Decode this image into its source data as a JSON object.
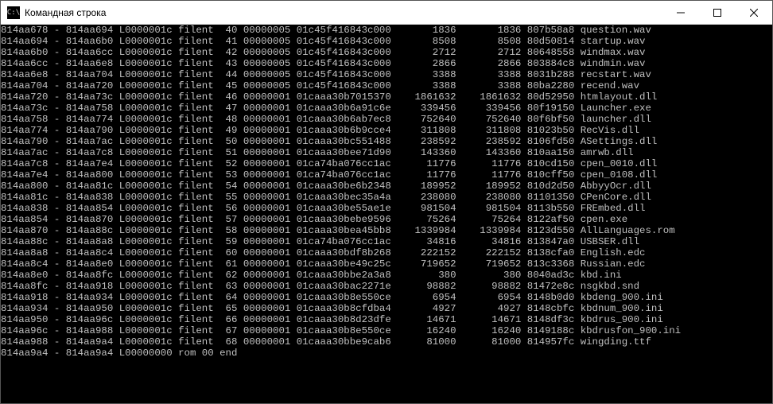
{
  "window": {
    "title": "Командная строка",
    "icon_text": "C:\\"
  },
  "rows": [
    {
      "addr1": "814aa678",
      "addr2": "814aa694",
      "lval": "L0000001c",
      "type": "filent",
      "idx": "40",
      "col6": "00000005",
      "col7": "01c45f416843c000",
      "col8": "      1836",
      "col9": "      1836",
      "col10": "807b58a8",
      "fname": "question.wav"
    },
    {
      "addr1": "814aa694",
      "addr2": "814aa6b0",
      "lval": "L0000001c",
      "type": "filent",
      "idx": "41",
      "col6": "00000005",
      "col7": "01c45f416843c000",
      "col8": "      8508",
      "col9": "      8508",
      "col10": "80d50814",
      "fname": "startup.wav"
    },
    {
      "addr1": "814aa6b0",
      "addr2": "814aa6cc",
      "lval": "L0000001c",
      "type": "filent",
      "idx": "42",
      "col6": "00000005",
      "col7": "01c45f416843c000",
      "col8": "      2712",
      "col9": "      2712",
      "col10": "80648558",
      "fname": "windmax.wav"
    },
    {
      "addr1": "814aa6cc",
      "addr2": "814aa6e8",
      "lval": "L0000001c",
      "type": "filent",
      "idx": "43",
      "col6": "00000005",
      "col7": "01c45f416843c000",
      "col8": "      2866",
      "col9": "      2866",
      "col10": "803884c8",
      "fname": "windmin.wav"
    },
    {
      "addr1": "814aa6e8",
      "addr2": "814aa704",
      "lval": "L0000001c",
      "type": "filent",
      "idx": "44",
      "col6": "00000005",
      "col7": "01c45f416843c000",
      "col8": "      3388",
      "col9": "      3388",
      "col10": "8031b288",
      "fname": "recstart.wav"
    },
    {
      "addr1": "814aa704",
      "addr2": "814aa720",
      "lval": "L0000001c",
      "type": "filent",
      "idx": "45",
      "col6": "00000005",
      "col7": "01c45f416843c000",
      "col8": "      3388",
      "col9": "      3388",
      "col10": "80ba2280",
      "fname": "recend.wav"
    },
    {
      "addr1": "814aa720",
      "addr2": "814aa73c",
      "lval": "L0000001c",
      "type": "filent",
      "idx": "46",
      "col6": "00000001",
      "col7": "01caaa30b7015370",
      "col8": "   1861632",
      "col9": "   1861632",
      "col10": "80d52950",
      "fname": "htmlayout.dll"
    },
    {
      "addr1": "814aa73c",
      "addr2": "814aa758",
      "lval": "L0000001c",
      "type": "filent",
      "idx": "47",
      "col6": "00000001",
      "col7": "01caaa30b6a91c6e",
      "col8": "    339456",
      "col9": "    339456",
      "col10": "80f19150",
      "fname": "Launcher.exe"
    },
    {
      "addr1": "814aa758",
      "addr2": "814aa774",
      "lval": "L0000001c",
      "type": "filent",
      "idx": "48",
      "col6": "00000001",
      "col7": "01caaa30b6ab7ec8",
      "col8": "    752640",
      "col9": "    752640",
      "col10": "80f6bf50",
      "fname": "launcher.dll"
    },
    {
      "addr1": "814aa774",
      "addr2": "814aa790",
      "lval": "L0000001c",
      "type": "filent",
      "idx": "49",
      "col6": "00000001",
      "col7": "01caaa30b6b9cce4",
      "col8": "    311808",
      "col9": "    311808",
      "col10": "81023b50",
      "fname": "RecVis.dll"
    },
    {
      "addr1": "814aa790",
      "addr2": "814aa7ac",
      "lval": "L0000001c",
      "type": "filent",
      "idx": "50",
      "col6": "00000001",
      "col7": "01caaa30bc551488",
      "col8": "    238592",
      "col9": "    238592",
      "col10": "8106fd50",
      "fname": "ASettings.dll"
    },
    {
      "addr1": "814aa7ac",
      "addr2": "814aa7c8",
      "lval": "L0000001c",
      "type": "filent",
      "idx": "51",
      "col6": "00000001",
      "col7": "01caaa30bee71d90",
      "col8": "    143360",
      "col9": "    143360",
      "col10": "810aa150",
      "fname": "amrwb.dll"
    },
    {
      "addr1": "814aa7c8",
      "addr2": "814aa7e4",
      "lval": "L0000001c",
      "type": "filent",
      "idx": "52",
      "col6": "00000001",
      "col7": "01ca74ba076cc1ac",
      "col8": "     11776",
      "col9": "     11776",
      "col10": "810cd150",
      "fname": "cpen_0010.dll"
    },
    {
      "addr1": "814aa7e4",
      "addr2": "814aa800",
      "lval": "L0000001c",
      "type": "filent",
      "idx": "53",
      "col6": "00000001",
      "col7": "01ca74ba076cc1ac",
      "col8": "     11776",
      "col9": "     11776",
      "col10": "810cff50",
      "fname": "cpen_0108.dll"
    },
    {
      "addr1": "814aa800",
      "addr2": "814aa81c",
      "lval": "L0000001c",
      "type": "filent",
      "idx": "54",
      "col6": "00000001",
      "col7": "01caaa30be6b2348",
      "col8": "    189952",
      "col9": "    189952",
      "col10": "810d2d50",
      "fname": "AbbyyOcr.dll"
    },
    {
      "addr1": "814aa81c",
      "addr2": "814aa838",
      "lval": "L0000001c",
      "type": "filent",
      "idx": "55",
      "col6": "00000001",
      "col7": "01caaa30bec35a4a",
      "col8": "    238080",
      "col9": "    238080",
      "col10": "81101350",
      "fname": "CPenCore.dll"
    },
    {
      "addr1": "814aa838",
      "addr2": "814aa854",
      "lval": "L0000001c",
      "type": "filent",
      "idx": "56",
      "col6": "00000001",
      "col7": "01caaa30be55ae1e",
      "col8": "    981504",
      "col9": "    981504",
      "col10": "8113b550",
      "fname": "FREmbed.dll"
    },
    {
      "addr1": "814aa854",
      "addr2": "814aa870",
      "lval": "L0000001c",
      "type": "filent",
      "idx": "57",
      "col6": "00000001",
      "col7": "01caaa30bebe9596",
      "col8": "     75264",
      "col9": "     75264",
      "col10": "8122af50",
      "fname": "cpen.exe"
    },
    {
      "addr1": "814aa870",
      "addr2": "814aa88c",
      "lval": "L0000001c",
      "type": "filent",
      "idx": "58",
      "col6": "00000001",
      "col7": "01caaa30bea45bb8",
      "col8": "   1339984",
      "col9": "   1339984",
      "col10": "8123d550",
      "fname": "AllLanguages.rom"
    },
    {
      "addr1": "814aa88c",
      "addr2": "814aa8a8",
      "lval": "L0000001c",
      "type": "filent",
      "idx": "59",
      "col6": "00000001",
      "col7": "01ca74ba076cc1ac",
      "col8": "     34816",
      "col9": "     34816",
      "col10": "813847a0",
      "fname": "USBSER.dll"
    },
    {
      "addr1": "814aa8a8",
      "addr2": "814aa8c4",
      "lval": "L0000001c",
      "type": "filent",
      "idx": "60",
      "col6": "00000001",
      "col7": "01caaa30bdf8b268",
      "col8": "    222152",
      "col9": "    222152",
      "col10": "8138cfa0",
      "fname": "English.edc"
    },
    {
      "addr1": "814aa8c4",
      "addr2": "814aa8e0",
      "lval": "L0000001c",
      "type": "filent",
      "idx": "61",
      "col6": "00000001",
      "col7": "01caaa30be49c25c",
      "col8": "    719652",
      "col9": "    719652",
      "col10": "813c3368",
      "fname": "Russian.edc"
    },
    {
      "addr1": "814aa8e0",
      "addr2": "814aa8fc",
      "lval": "L0000001c",
      "type": "filent",
      "idx": "62",
      "col6": "00000001",
      "col7": "01caaa30bbe2a3a8",
      "col8": "       380",
      "col9": "       380",
      "col10": "8040ad3c",
      "fname": "kbd.ini"
    },
    {
      "addr1": "814aa8fc",
      "addr2": "814aa918",
      "lval": "L0000001c",
      "type": "filent",
      "idx": "63",
      "col6": "00000001",
      "col7": "01caaa30bac2271e",
      "col8": "     98882",
      "col9": "     98882",
      "col10": "81472e8c",
      "fname": "nsgkbd.snd"
    },
    {
      "addr1": "814aa918",
      "addr2": "814aa934",
      "lval": "L0000001c",
      "type": "filent",
      "idx": "64",
      "col6": "00000001",
      "col7": "01caaa30b8e550ce",
      "col8": "      6954",
      "col9": "      6954",
      "col10": "8148b0d0",
      "fname": "kbdeng_900.ini"
    },
    {
      "addr1": "814aa934",
      "addr2": "814aa950",
      "lval": "L0000001c",
      "type": "filent",
      "idx": "65",
      "col6": "00000001",
      "col7": "01caaa30b8cfdba4",
      "col8": "      4927",
      "col9": "      4927",
      "col10": "8148cbfc",
      "fname": "kbdnum_900.ini"
    },
    {
      "addr1": "814aa950",
      "addr2": "814aa96c",
      "lval": "L0000001c",
      "type": "filent",
      "idx": "66",
      "col6": "00000001",
      "col7": "01caaa30b8d23dfe",
      "col8": "     14671",
      "col9": "     14671",
      "col10": "8148df3c",
      "fname": "kbdrus_900.ini"
    },
    {
      "addr1": "814aa96c",
      "addr2": "814aa988",
      "lval": "L0000001c",
      "type": "filent",
      "idx": "67",
      "col6": "00000001",
      "col7": "01caaa30b8e550ce",
      "col8": "     16240",
      "col9": "     16240",
      "col10": "8149188c",
      "fname": "kbdrusfon_900.ini"
    },
    {
      "addr1": "814aa988",
      "addr2": "814aa9a4",
      "lval": "L0000001c",
      "type": "filent",
      "idx": "68",
      "col6": "00000001",
      "col7": "01caaa30bbe9cab6",
      "col8": "     81000",
      "col9": "     81000",
      "col10": "814957fc",
      "fname": "wingding.ttf"
    }
  ],
  "last_line": "814aa9a4 - 814aa9a4 L00000000 rom 00 end"
}
